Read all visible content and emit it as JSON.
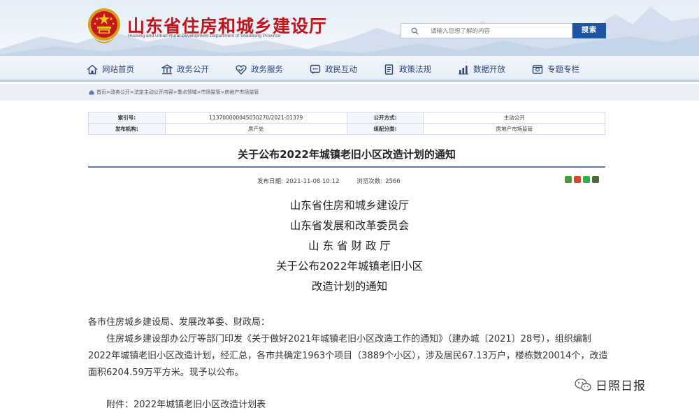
{
  "header": {
    "site_title": "山东省住房和城乡建设厅",
    "site_subtitle": "Housing and Urban-Rural Development Department of Shandong Province",
    "emblem_icon": "national-emblem-icon",
    "search": {
      "placeholder": "请输入您想了解的内容",
      "button_label": "搜索"
    },
    "colors": {
      "title_red": "#c0151c",
      "search_button_blue": "#1d55a4"
    }
  },
  "nav": {
    "items": [
      {
        "label": "网站首页",
        "icon": "home-icon"
      },
      {
        "label": "政务公开",
        "icon": "institution-icon"
      },
      {
        "label": "政务服务",
        "icon": "service-icon"
      },
      {
        "label": "政民互动",
        "icon": "interaction-icon"
      },
      {
        "label": "政策法规",
        "icon": "policy-icon"
      },
      {
        "label": "数据开放",
        "icon": "data-icon"
      },
      {
        "label": "专题专栏",
        "icon": "topic-icon"
      }
    ]
  },
  "breadcrumb": "首页>政务公开>法定主动公开内容>重点领域>市场监管>房地产市场监管",
  "meta": {
    "index_label": "索引号:",
    "index_value": "113700000045030270/2021-01379",
    "publicity_label": "公开方式:",
    "publicity_value": "主动公开",
    "org_label": "发布机构:",
    "org_value": "房产处",
    "category_label": "组配分类:",
    "category_value": "房地产市场监管"
  },
  "document": {
    "title": "关于公布2022年城镇老旧小区改造计划的通知",
    "publish_date_label": "发布日期:",
    "publish_date": "2021-11-08 10:12",
    "views_label": "浏览次数:",
    "views": "2566",
    "share_icons": [
      "share-weibo-icon",
      "share-qzone-icon",
      "share-wechat-icon",
      "share-print-icon"
    ],
    "heading_lines": [
      "山东省住房和城乡建设厅",
      "山东省发展和改革委员会",
      "山 东 省 财 政 厅",
      "关于公布2022年城镇老旧小区",
      "改造计划的通知"
    ],
    "salutation": "各市住房城乡建设局、发展改革委、财政局：",
    "body_lines": [
      "住房城乡建设部办公厅等部门印发《关于做好2021年城镇老旧小区改造工作的通知》（建办城〔2021〕28号），组织编制",
      "2022年城镇老旧小区改造计划，经汇总，各市共确定1963个项目（3889个小区），涉及居民67.13万户，楼栋数20014个，改造",
      "面积6204.59万平方米。现予以公布。"
    ],
    "attachment": "附件：2022年城镇老旧小区改造计划表"
  },
  "watermark": {
    "icon": "wechat-icon",
    "text": "日照日报"
  }
}
